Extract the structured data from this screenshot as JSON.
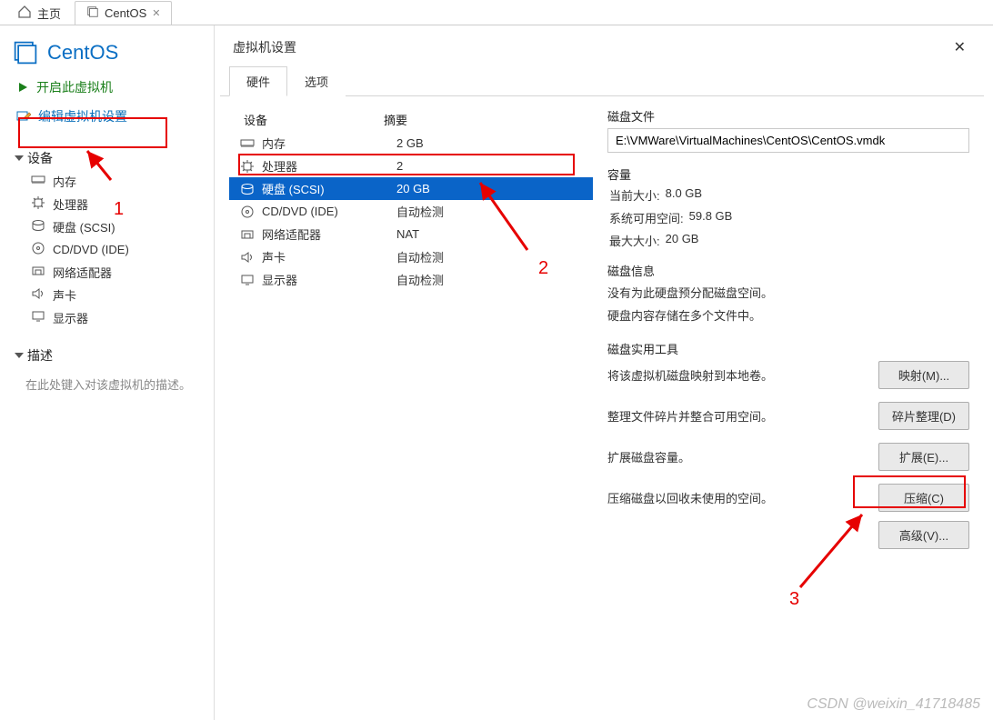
{
  "app_tabs": {
    "home_label": "主页",
    "vm_tab_label": "CentOS"
  },
  "sidebar": {
    "vm_name": "CentOS",
    "action_start": "开启此虚拟机",
    "action_edit": "编辑虚拟机设置",
    "devices_title": "设备",
    "devices": [
      {
        "label": "内存",
        "icon": "memory"
      },
      {
        "label": "处理器",
        "icon": "cpu"
      },
      {
        "label": "硬盘 (SCSI)",
        "icon": "disk"
      },
      {
        "label": "CD/DVD (IDE)",
        "icon": "cddvd"
      },
      {
        "label": "网络适配器",
        "icon": "network"
      },
      {
        "label": "声卡",
        "icon": "sound"
      },
      {
        "label": "显示器",
        "icon": "display"
      }
    ],
    "desc_title": "描述",
    "desc_placeholder": "在此处键入对该虚拟机的描述。"
  },
  "dialog": {
    "title": "虚拟机设置",
    "tabs": {
      "hardware": "硬件",
      "options": "选项"
    },
    "device_col_header": "设备",
    "summary_col_header": "摘要",
    "devices": [
      {
        "label": "内存",
        "summary": "2 GB",
        "icon": "memory",
        "selected": false
      },
      {
        "label": "处理器",
        "summary": "2",
        "icon": "cpu",
        "selected": false
      },
      {
        "label": "硬盘 (SCSI)",
        "summary": "20 GB",
        "icon": "disk",
        "selected": true
      },
      {
        "label": "CD/DVD (IDE)",
        "summary": "自动检测",
        "icon": "cddvd",
        "selected": false
      },
      {
        "label": "网络适配器",
        "summary": "NAT",
        "icon": "network",
        "selected": false
      },
      {
        "label": "声卡",
        "summary": "自动检测",
        "icon": "sound",
        "selected": false
      },
      {
        "label": "显示器",
        "summary": "自动检测",
        "icon": "display",
        "selected": false
      }
    ],
    "right": {
      "disk_file_label": "磁盘文件",
      "disk_file_value": "E:\\VMWare\\VirtualMachines\\CentOS\\CentOS.vmdk",
      "capacity_label": "容量",
      "current_size_label": "当前大小:",
      "current_size_value": "8.0 GB",
      "sys_avail_label": "系统可用空间:",
      "sys_avail_value": "59.8 GB",
      "max_size_label": "最大大小:",
      "max_size_value": "20 GB",
      "disk_info_label": "磁盘信息",
      "disk_info_line1": "没有为此硬盘预分配磁盘空间。",
      "disk_info_line2": "硬盘内容存储在多个文件中。",
      "util_label": "磁盘实用工具",
      "map_text": "将该虚拟机磁盘映射到本地卷。",
      "map_btn": "映射(M)...",
      "defrag_text": "整理文件碎片并整合可用空间。",
      "defrag_btn": "碎片整理(D)",
      "expand_text": "扩展磁盘容量。",
      "expand_btn": "扩展(E)...",
      "compact_text": "压缩磁盘以回收未使用的空间。",
      "compact_btn": "压缩(C)",
      "advanced_btn": "高级(V)..."
    }
  },
  "annotations": {
    "n1": "1",
    "n2": "2",
    "n3": "3"
  },
  "watermark": "CSDN @weixin_41718485"
}
